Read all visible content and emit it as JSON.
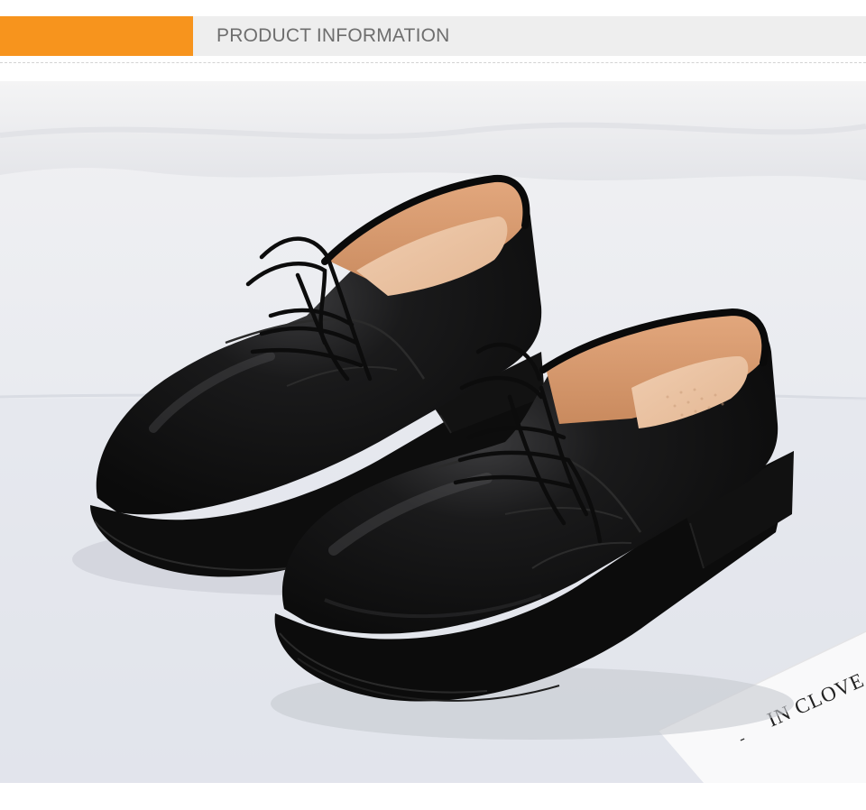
{
  "header": {
    "title": "PRODUCT INFORMATION",
    "accent_color": "#f7941d",
    "bar_color": "#eeeeee"
  },
  "product_photo": {
    "card_text": "IN CLOVE",
    "card_dash": "-",
    "subject_icon": "shoe-pair-icon"
  }
}
